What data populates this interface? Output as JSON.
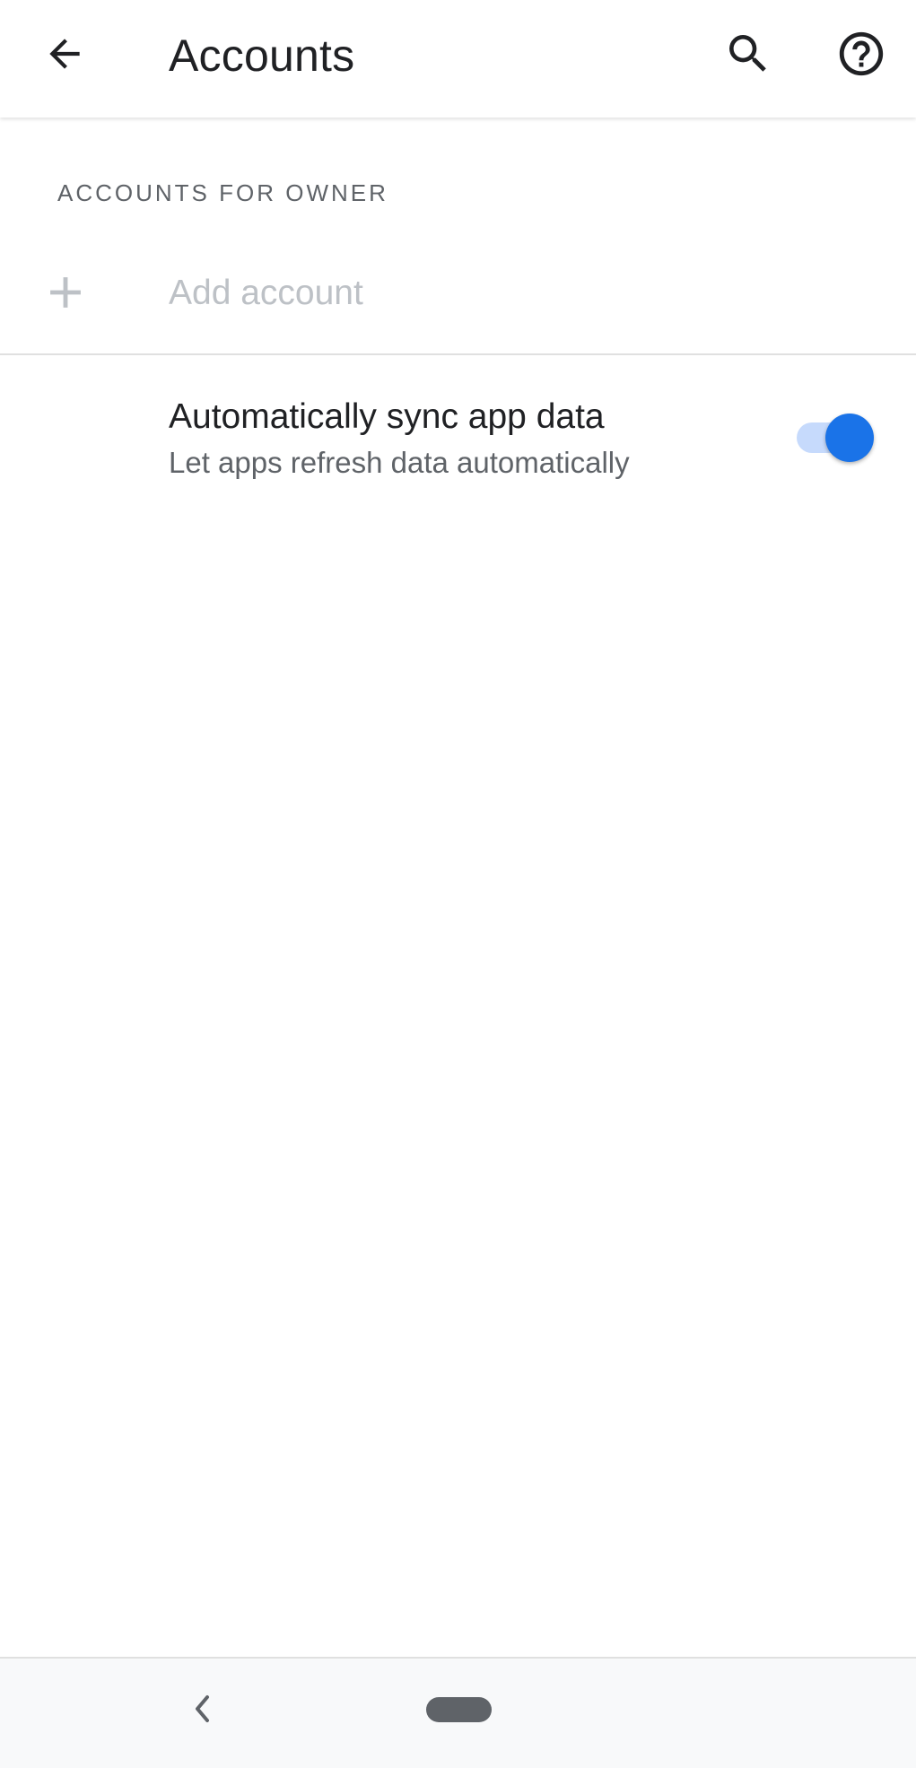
{
  "appbar": {
    "title": "Accounts",
    "back_icon": "arrow-back-icon",
    "search_icon": "search-icon",
    "help_icon": "help-icon"
  },
  "section": {
    "header": "ACCOUNTS FOR OWNER"
  },
  "add_account": {
    "icon": "plus-icon",
    "label": "Add account"
  },
  "sync": {
    "title": "Automatically sync app data",
    "summary": "Let apps refresh data automatically",
    "enabled": true
  },
  "navbar": {
    "back_icon": "nav-back-icon",
    "home_icon": "home-pill-icon"
  },
  "colors": {
    "accent": "#1a73e8",
    "accent_track": "#c6dafc",
    "primary_text": "#202124",
    "secondary_text": "#5f6368",
    "disabled_text": "#bdc1c6"
  }
}
